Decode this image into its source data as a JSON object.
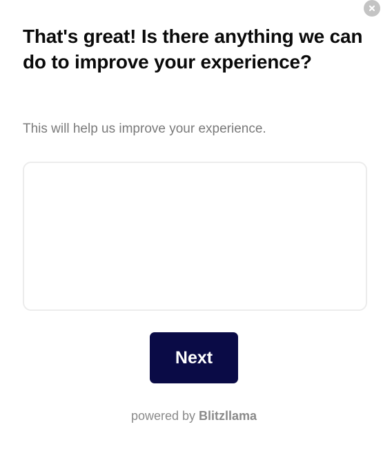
{
  "survey": {
    "question": "That's great! Is there anything we can do to improve your experience?",
    "subtitle": "This will help us improve your experience.",
    "answer_value": "",
    "answer_placeholder": "",
    "next_label": "Next"
  },
  "footer": {
    "powered_by": "powered by",
    "brand": "Blitzllama"
  },
  "icons": {
    "close": "close-icon"
  },
  "colors": {
    "button_bg": "#0a0b46",
    "close_bg": "#c4c4c4",
    "subtitle": "#7a7a7a"
  }
}
